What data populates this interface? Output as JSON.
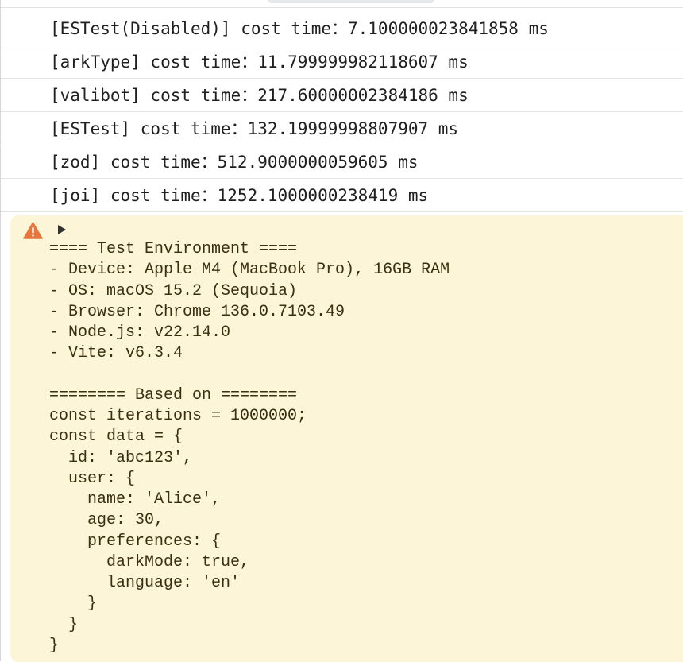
{
  "log_entries": [
    "[ESTest(Disabled)] cost time：7.100000023841858 ms",
    "[arkType] cost time：11.799999982118607 ms",
    "[valibot] cost time：217.60000002384186 ms",
    "[ESTest] cost time：132.19999998807907 ms",
    "[zod] cost time：512.9000000059605 ms",
    "[joi] cost time：1252.1000000238419 ms"
  ],
  "warning": {
    "icon": "warning-icon",
    "expand_icon": "expand-arrow-icon",
    "accent_color": "#e8753a",
    "background_color": "#fcf5d7",
    "lines": [
      "==== Test Environment ====",
      "- Device: Apple M4 (MacBook Pro), 16GB RAM",
      "- OS: macOS 15.2 (Sequoia)",
      "- Browser: Chrome 136.0.7103.49",
      "- Node.js: v22.14.0",
      "- Vite: v6.3.4",
      "",
      "======== Based on ========",
      "const iterations = 1000000;",
      "const data = {",
      "  id: 'abc123',",
      "  user: {",
      "    name: 'Alice',",
      "    age: 30,",
      "    preferences: {",
      "      darkMode: true,",
      "      language: 'en'",
      "    }",
      "  }",
      "}"
    ]
  }
}
